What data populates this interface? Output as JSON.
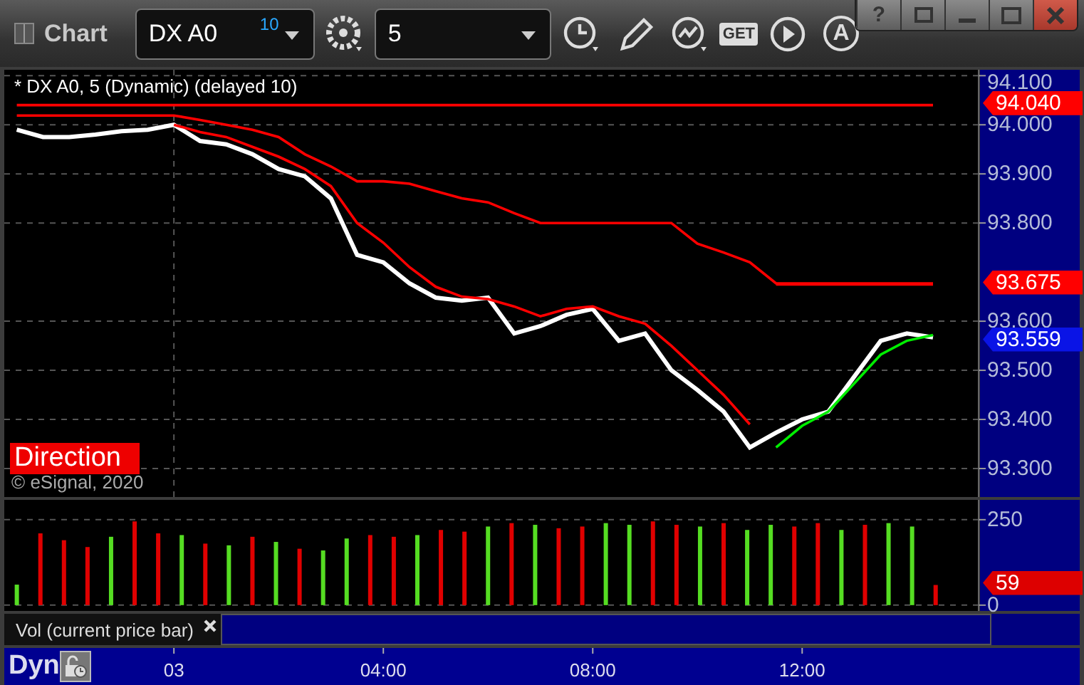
{
  "window": {
    "title": "Chart",
    "controls": [
      {
        "kind": "help",
        "label": "?"
      },
      {
        "kind": "restore"
      },
      {
        "kind": "minimize"
      },
      {
        "kind": "maximize"
      },
      {
        "kind": "close"
      }
    ]
  },
  "toolbar": {
    "symbol": "DX A0",
    "symbol_badge": "10",
    "interval": "5",
    "tools": [
      {
        "kind": "settings"
      },
      {
        "kind": "clock"
      },
      {
        "kind": "pencil"
      },
      {
        "kind": "study"
      },
      {
        "kind": "get",
        "label": "GET"
      },
      {
        "kind": "play"
      },
      {
        "kind": "alert",
        "label": "A"
      }
    ]
  },
  "price_panel": {
    "legend": "* DX A0, 5 (Dynamic) (delayed 10)",
    "tag": "Direction",
    "copyright": "© eSignal, 2020",
    "markers": [
      {
        "label": "94.040",
        "color": "#ff0000"
      },
      {
        "label": "93.675",
        "color": "#ff0000"
      },
      {
        "label": "93.559",
        "color": "#0a14e6"
      }
    ],
    "chart_data": {
      "type": "line",
      "grid": true,
      "xlim": [
        -3.24,
        15.37
      ],
      "ylim": [
        93.242,
        94.112
      ],
      "x": [
        -3,
        -2.5,
        -2,
        -1.5,
        -1,
        -0.5,
        0,
        0.5,
        1,
        1.5,
        2,
        2.5,
        3,
        3.5,
        4,
        4.5,
        5,
        5.5,
        6,
        6.5,
        7,
        7.5,
        8,
        8.5,
        9,
        9.5,
        10,
        10.5,
        11,
        11.5,
        12,
        12.5,
        13,
        13.5,
        14,
        14.5
      ],
      "yticks": [
        {
          "value": 94.1,
          "label": "94.100"
        },
        {
          "value": 94.0,
          "label": "94.000"
        },
        {
          "value": 93.9,
          "label": "93.900"
        },
        {
          "value": 93.8,
          "label": "93.800"
        },
        {
          "value": 93.6,
          "label": "93.600"
        },
        {
          "value": 93.5,
          "label": "93.500"
        },
        {
          "value": 93.4,
          "label": "93.400"
        },
        {
          "value": 93.3,
          "label": "93.300"
        }
      ],
      "series": [
        {
          "color": "#ffffff",
          "values": [
            93.99,
            93.975,
            93.975,
            93.98,
            93.987,
            93.99,
            94.0,
            93.967,
            93.96,
            93.94,
            93.91,
            93.895,
            93.85,
            93.735,
            93.72,
            93.677,
            93.648,
            93.642,
            93.648,
            93.575,
            93.59,
            93.613,
            93.625,
            93.56,
            93.575,
            93.5,
            93.46,
            93.416,
            93.343,
            93.373,
            93.4,
            93.416,
            93.488,
            93.56,
            93.575,
            93.567
          ]
        },
        {
          "color": "#ff0000",
          "values": [
            94.019,
            94.019,
            94.019,
            94.019,
            94.019,
            94.019,
            94.019,
            94.01,
            94.0,
            93.99,
            93.975,
            93.94,
            93.915,
            93.885,
            93.885,
            93.88,
            93.865,
            93.85,
            93.842,
            93.82,
            93.8,
            93.8,
            93.8,
            93.8,
            93.8,
            93.8,
            93.758,
            93.74,
            93.72,
            93.677,
            93.677,
            93.677,
            93.677,
            93.677,
            93.677,
            93.677
          ]
        },
        {
          "color": "#ff0000",
          "values": [
            null,
            null,
            null,
            null,
            null,
            null,
            94.0,
            93.985,
            93.975,
            93.955,
            93.935,
            93.91,
            93.875,
            93.8,
            93.76,
            93.71,
            93.67,
            93.65,
            93.645,
            93.63,
            93.61,
            93.625,
            93.63,
            93.61,
            93.595,
            93.55,
            93.5,
            93.45,
            93.39,
            null,
            null,
            null,
            null,
            null,
            null,
            null
          ]
        },
        {
          "color": "#00ee00",
          "values": [
            null,
            null,
            null,
            null,
            null,
            null,
            null,
            null,
            null,
            null,
            null,
            null,
            null,
            null,
            null,
            null,
            null,
            null,
            null,
            null,
            null,
            null,
            null,
            null,
            null,
            null,
            null,
            null,
            null,
            93.343,
            93.387,
            93.416,
            93.474,
            93.532,
            93.56,
            93.572
          ]
        },
        {
          "color": "#ff0000",
          "values": [
            94.04,
            94.04,
            94.04,
            94.04,
            94.04,
            94.04,
            94.04,
            94.04,
            94.04,
            94.04,
            94.04,
            94.04,
            94.04,
            94.04,
            94.04,
            94.04,
            94.04,
            94.04,
            94.04,
            94.04,
            94.04,
            94.04,
            94.04,
            94.04,
            94.04,
            94.04,
            94.04,
            94.04,
            94.04,
            94.04,
            94.04,
            94.04,
            94.04,
            94.04,
            94.04,
            94.04
          ]
        },
        {
          "color": "#ff0000",
          "values": [
            null,
            null,
            null,
            null,
            null,
            null,
            null,
            null,
            null,
            null,
            null,
            null,
            null,
            null,
            null,
            null,
            null,
            null,
            null,
            null,
            null,
            null,
            null,
            null,
            null,
            null,
            null,
            null,
            null,
            93.675,
            93.675,
            93.675,
            93.675,
            93.675,
            93.675,
            93.675
          ]
        }
      ]
    }
  },
  "volume_panel": {
    "legend": "Vol (current price bar)",
    "markers": [
      {
        "label": "59",
        "color": "#dd0000"
      }
    ],
    "chart_data": {
      "type": "bar",
      "stacked": true,
      "grid": true,
      "xlim": [
        -3.24,
        15.37
      ],
      "ylim": [
        -17,
        308
      ],
      "yticks": [
        0,
        250
      ],
      "xticks": [
        {
          "value": 4,
          "label": "04:00"
        },
        {
          "value": 8,
          "label": "08:00"
        },
        {
          "value": 12,
          "label": "12:00"
        }
      ],
      "x": [
        -3,
        -2.55,
        -2.1,
        -1.65,
        -1.2,
        -0.75,
        -0.3,
        0.15,
        0.6,
        1.05,
        1.5,
        1.95,
        2.4,
        2.85,
        3.3,
        3.75,
        4.2,
        4.65,
        5.1,
        5.55,
        6,
        6.45,
        6.9,
        7.35,
        7.8,
        8.25,
        8.7,
        9.15,
        9.6,
        10.05,
        10.5,
        10.95,
        11.4,
        11.85,
        12.3,
        12.75,
        13.2,
        13.65,
        14.1,
        14.55
      ],
      "series": [
        {
          "color": "#55dd22",
          "values": [
            60,
            null,
            null,
            null,
            200,
            null,
            null,
            205,
            null,
            175,
            null,
            185,
            null,
            160,
            195,
            null,
            null,
            205,
            null,
            null,
            230,
            null,
            235,
            null,
            null,
            240,
            235,
            null,
            null,
            230,
            null,
            220,
            235,
            null,
            null,
            220,
            null,
            240,
            230,
            null
          ]
        },
        {
          "color": "#e00000",
          "values": [
            null,
            210,
            190,
            170,
            null,
            245,
            210,
            null,
            180,
            null,
            200,
            null,
            165,
            null,
            null,
            205,
            200,
            null,
            220,
            215,
            null,
            240,
            null,
            225,
            230,
            null,
            null,
            245,
            235,
            null,
            240,
            null,
            null,
            230,
            240,
            null,
            235,
            null,
            null,
            59
          ]
        }
      ]
    }
  },
  "time_axis": {
    "mode": "Dyn",
    "day_label": "03"
  }
}
